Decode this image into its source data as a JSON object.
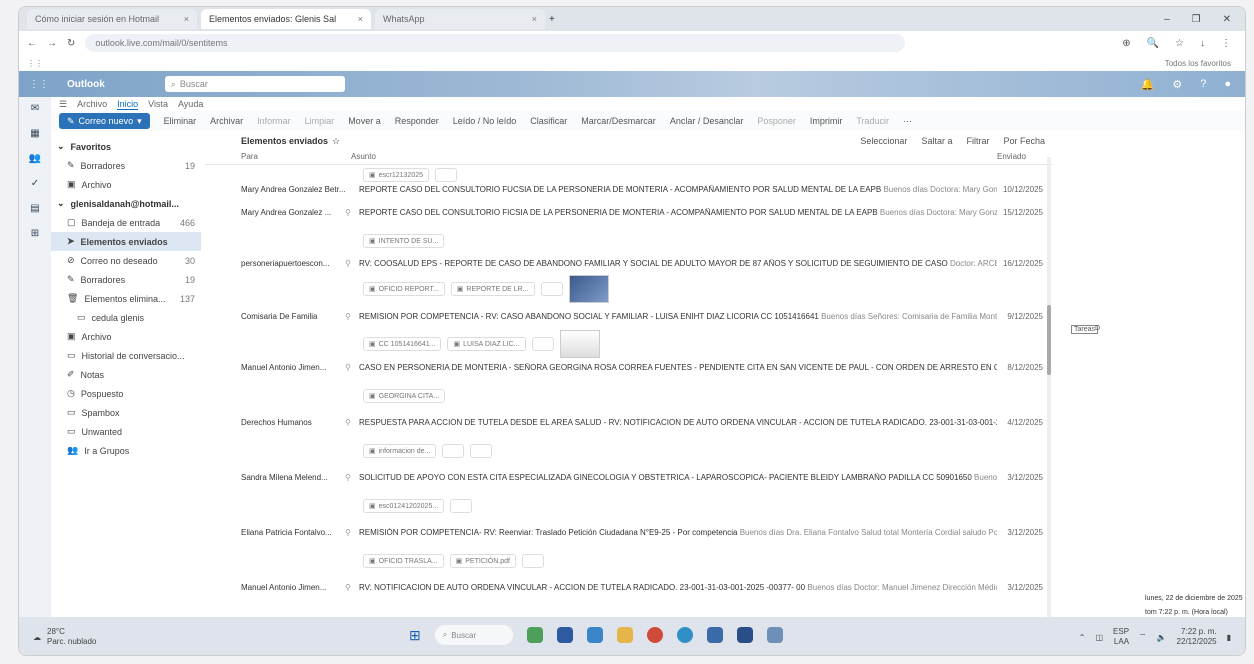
{
  "browser": {
    "tabs": [
      {
        "label": "Cómo iniciar sesión en Hotmail"
      },
      {
        "label": "Elementos enviados: Glenis Sal"
      },
      {
        "label": "WhatsApp"
      }
    ],
    "url": "outlook.live.com/mail/0/sentitems",
    "all_favorites": "Todos los favoritos"
  },
  "owa": {
    "brand": "Outlook",
    "search_placeholder": "Buscar",
    "menu": [
      "Archivo",
      "Inicio",
      "Vista",
      "Ayuda"
    ],
    "toolbar": {
      "new_mail": "Correo nuevo",
      "delete": "Eliminar",
      "archive": "Archivar",
      "report": "Informar",
      "sweep": "Limpiar",
      "move": "Mover a",
      "reply": "Responder",
      "read_unread": "Leído / No leído",
      "classify": "Clasificar",
      "flag": "Marcar/Desmarcar",
      "pin": "Anclar / Desanclar",
      "snooze": "Posponer",
      "print": "Imprimir",
      "translate": "Traducir"
    }
  },
  "folders": [
    {
      "label": "Favoritos",
      "type": "head"
    },
    {
      "label": "Borradores",
      "count": "19"
    },
    {
      "label": "Archivo"
    },
    {
      "label": "glenisaldanah@hotmail...",
      "type": "head"
    },
    {
      "label": "Bandeja de entrada",
      "count": "466"
    },
    {
      "label": "Elementos enviados",
      "type": "sel"
    },
    {
      "label": "Correo no deseado",
      "count": "30"
    },
    {
      "label": "Borradores",
      "count": "19"
    },
    {
      "label": "Elementos elimina...",
      "count": "137"
    },
    {
      "label": "cedula glenis",
      "type": "sub"
    },
    {
      "label": "Archivo"
    },
    {
      "label": "Historial de conversacio..."
    },
    {
      "label": "Notas"
    },
    {
      "label": "Pospuesto"
    },
    {
      "label": "Spambox"
    },
    {
      "label": "Unwanted"
    },
    {
      "label": "Ir a Grupos"
    }
  ],
  "list": {
    "title": "Elementos enviados",
    "select": "Seleccionar",
    "jump": "Saltar a",
    "filter": "Filtrar",
    "sort": "Por Fecha",
    "col_to": "Para",
    "col_subject": "Asunto",
    "col_sent": "Enviado",
    "top_attachment": "escr12132025",
    "rows": [
      {
        "from": "Mary Andrea Gonzalez Betr...",
        "subject": "REPORTE CASO DEL CONSULTORIO FUCSIA DE LA PERSONERIA DE MONTERIA - ACOMPAÑAMIENTO POR SALUD MENTAL DE LA EAPB",
        "preview": "Buenos días Doctora: Mary Gonzalez LA...",
        "date": "10/12/2025",
        "attachments": []
      },
      {
        "from": "Mary Andrea Gonzalez ...",
        "subject": "REPORTE CASO DEL CONSULTORIO FICSIA DE LA PERSONERIA DE MONTERIA - ACOMPAÑAMIENTO POR SALUD MENTAL DE LA EAPB",
        "preview": "Buenos días Doctora: Mary Gonzalez LA...",
        "date": "15/12/2025",
        "attachments": [
          "INTENTO DE SU..."
        ]
      },
      {
        "from": "personeriapuertoescon...",
        "subject": "RV: COOSALUD EPS - REPORTE DE CASO DE ABANDONO FAMILIAR Y SOCIAL DE ADULTO MAYOR DE 87 AÑOS Y SOLICITUD DE SEGUIMIENTO DE CASO",
        "preview": "Doctor: ARCELIO MAN...",
        "date": "16/12/2025",
        "attachments": [
          "OFICIO REPORT...",
          "REPORTE DE LR..."
        ]
      },
      {
        "from": "Comisaria De Familia",
        "subject": "REMISION POR COMPETENCIA - RV: CASO ABANDONO SOCIAL Y FAMILIAR - LUISA ENIHT DIAZ LICORIA CC 1051416641",
        "preview": "Buenos días Señores: Comisaria de Familia Montería C...",
        "date": "9/12/2025",
        "attachments": [
          "CC 1051416641...",
          "LUISA DIAZ LIC..."
        ]
      },
      {
        "from": "Manuel Antonio Jimen...",
        "subject": "CASO EN PERSONERIA DE MONTERIA - SEÑORA GEORGINA ROSA CORREA FUENTES - PENDIENTE CITA EN SAN VICENTE DE PAUL - CON ORDEN DE ARRESTO EN CONTRA DE ...",
        "preview": "",
        "date": "8/12/2025",
        "attachments": [
          "GEORGINA CITA..."
        ]
      },
      {
        "from": "Derechos Humanos",
        "subject": "RESPUESTA PARA ACCION DE TUTELA DESDE EL AREA SALUD - RV: NOTIFICACION DE AUTO ORDENA VINCULAR - ACCION DE TUTELA RADICADO. 23-001-31-03-001-2025 -003...",
        "preview": "",
        "date": "4/12/2025",
        "attachments": [
          "informacion de..."
        ]
      },
      {
        "from": "Sandra Milena Melend...",
        "subject": "SOLICITUD DE APOYO CON ESTA CITA ESPECIALIZADA GINECOLOGIA Y OBSTETRICA - LAPAROSCOPICA- PACIENTE BLEIDY LAMBRAÑO PADILLA CC 50901650",
        "preview": "Buenos tardes Dr...",
        "date": "3/12/2025",
        "attachments": [
          "esc01241202025..."
        ]
      },
      {
        "from": "Eliana Patricia Fontalvo...",
        "subject": "REMISIÓN POR COMPETENCIA- RV: Reenviar: Traslado Petición Ciudadana N°E9-25 - Por competencia",
        "preview": "Buenos días Dra. Eliana Fontalvo Salud total Montería Cordial saludo Por...",
        "date": "3/12/2025",
        "attachments": [
          "OFICIO TRASLA...",
          "PETICIÓN.pdf"
        ]
      },
      {
        "from": "Manuel Antonio Jimen...",
        "subject": "RV: NOTIFICACION DE AUTO ORDENA VINCULAR - ACCION DE TUTELA RADICADO. 23-001-31-03-001-2025 -00377- 00",
        "preview": "Buenos días Doctor: Manuel Jimenez Dirección Médica ...",
        "date": "3/12/2025",
        "attachments": []
      }
    ]
  },
  "right": {
    "tag": "Tareas",
    "date_line1": "lunes, 22 de diciembre de 2025",
    "date_line2": "tom 7:22 p. m. (Hora local)"
  },
  "taskbar": {
    "temp": "28°C",
    "weather": "Parc. nublado",
    "search": "Buscar",
    "lang": "ESP",
    "lang2": "LAA",
    "time": "7:22 p. m.",
    "date": "22/12/2025"
  }
}
